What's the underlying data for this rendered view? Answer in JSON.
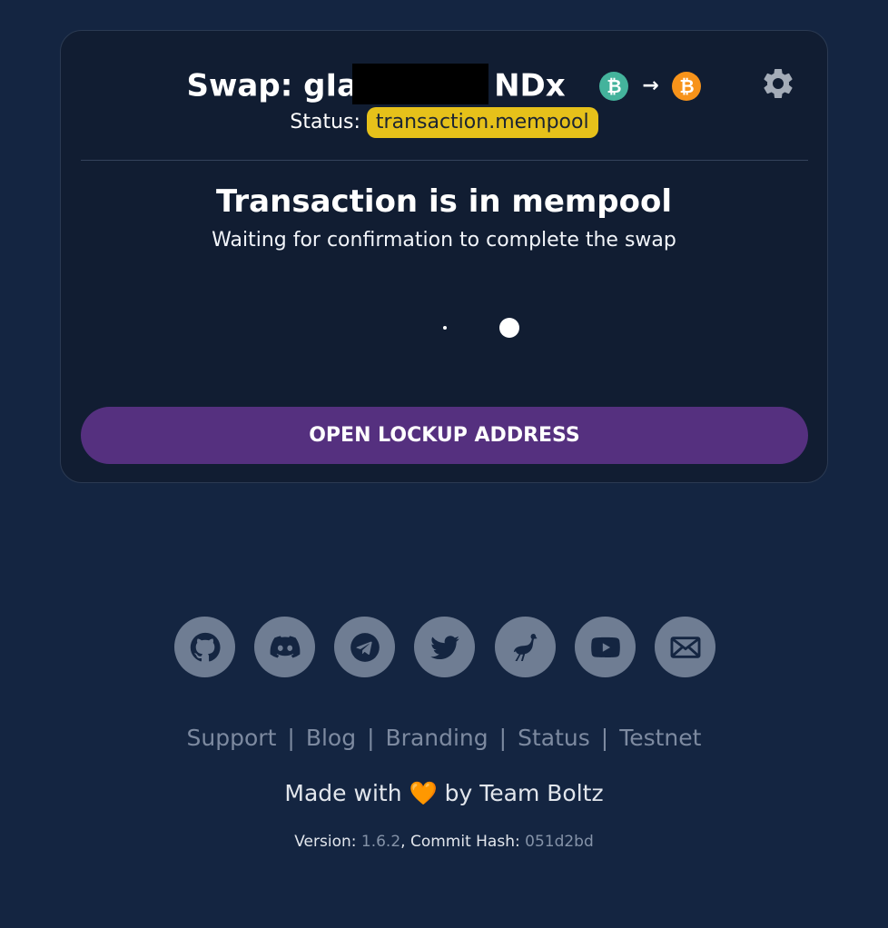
{
  "swap": {
    "title_prefix": "Swap: gIa",
    "title_suffix": "NDx",
    "from_asset_icon": "bitcoin-icon",
    "to_asset_icon": "bitcoin-icon",
    "from_color": "#44b39c",
    "to_color": "#f7931a",
    "arrow": "→",
    "coin_symbol": "₿",
    "status_label": "Status:",
    "status_value": "transaction.mempool",
    "status_color": "#e6c11a"
  },
  "main": {
    "heading": "Transaction is in mempool",
    "subheading": "Waiting for confirmation to complete the swap",
    "button_label": "OPEN LOCKUP ADDRESS",
    "button_color": "#55307f"
  },
  "footer": {
    "social": [
      "github-icon",
      "discord-icon",
      "telegram-icon",
      "twitter-icon",
      "nostr-icon",
      "youtube-icon",
      "email-icon"
    ],
    "links": [
      "Support",
      "Blog",
      "Branding",
      "Status",
      "Testnet"
    ],
    "separator": "|",
    "made_prefix": "Made with",
    "heart": "🧡",
    "made_suffix": "by Team Boltz",
    "version_label": "Version:",
    "version_value": "1.6.2",
    "commit_label": ", Commit Hash:",
    "commit_value": "051d2bd"
  },
  "colors": {
    "background": "#142541",
    "card": "#111d32",
    "social_bg": "#6f7d93"
  }
}
